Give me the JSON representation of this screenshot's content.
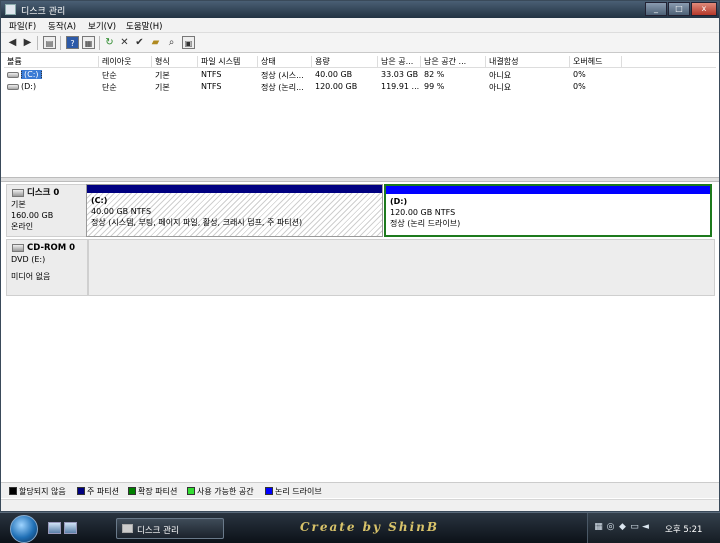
{
  "window": {
    "title": "디스크 관리",
    "minimize": "_",
    "maximize": "□",
    "close": "x"
  },
  "menu": [
    "파일(F)",
    "동작(A)",
    "보기(V)",
    "도움말(H)"
  ],
  "toolbar_icons": [
    "back-icon",
    "forward-icon",
    "show-hide-icon",
    "help-icon",
    "properties-icon",
    "refresh-icon",
    "delete-icon",
    "check-icon",
    "open-icon",
    "explore-icon",
    "settings-icon"
  ],
  "table": {
    "headers": [
      "볼륨",
      "레이아웃",
      "형식",
      "파일 시스템",
      "상태",
      "용량",
      "남은 공...",
      "남은 공간 ...",
      "내결함성",
      "오버헤드"
    ],
    "rows": [
      [
        "(C:)",
        "단순",
        "기본",
        "NTFS",
        "정상 (시스...",
        "40.00 GB",
        "33.03 GB",
        "82 %",
        "아니요",
        "0%"
      ],
      [
        "(D:)",
        "단순",
        "기본",
        "NTFS",
        "정상 (논리...",
        "120.00 GB",
        "119.91 ...",
        "99 %",
        "아니요",
        "0%"
      ]
    ]
  },
  "disks": {
    "disk0": {
      "name": "디스크 0",
      "type": "기본",
      "size": "160.00 GB",
      "status": "온라인",
      "partitions": [
        {
          "label": "(C:)",
          "size": "40.00 GB NTFS",
          "status": "정상 (시스템, 부팅, 페이지 파일, 활성, 크래시 덤프, 주 파티션)",
          "bar_color": "#000080"
        },
        {
          "label": "(D:)",
          "size": "120.00 GB NTFS",
          "status": "정상 (논리 드라이브)",
          "bar_color": "#0000ff"
        }
      ]
    },
    "cdrom0": {
      "name": "CD-ROM 0",
      "drive": "DVD (E:)",
      "status": "미디어 없음"
    }
  },
  "legend": [
    {
      "label": "할당되지 않음",
      "color": "#000000"
    },
    {
      "label": "주 파티션",
      "color": "#000080"
    },
    {
      "label": "확장 파티션",
      "color": "#008000"
    },
    {
      "label": "사용 가능한 공간",
      "color": "#33dd33"
    },
    {
      "label": "논리 드라이브",
      "color": "#0000ff"
    }
  ],
  "taskbar": {
    "task_label": "디스크 관리",
    "credit": "Create by ShinB",
    "clock": "오후 5:21"
  }
}
